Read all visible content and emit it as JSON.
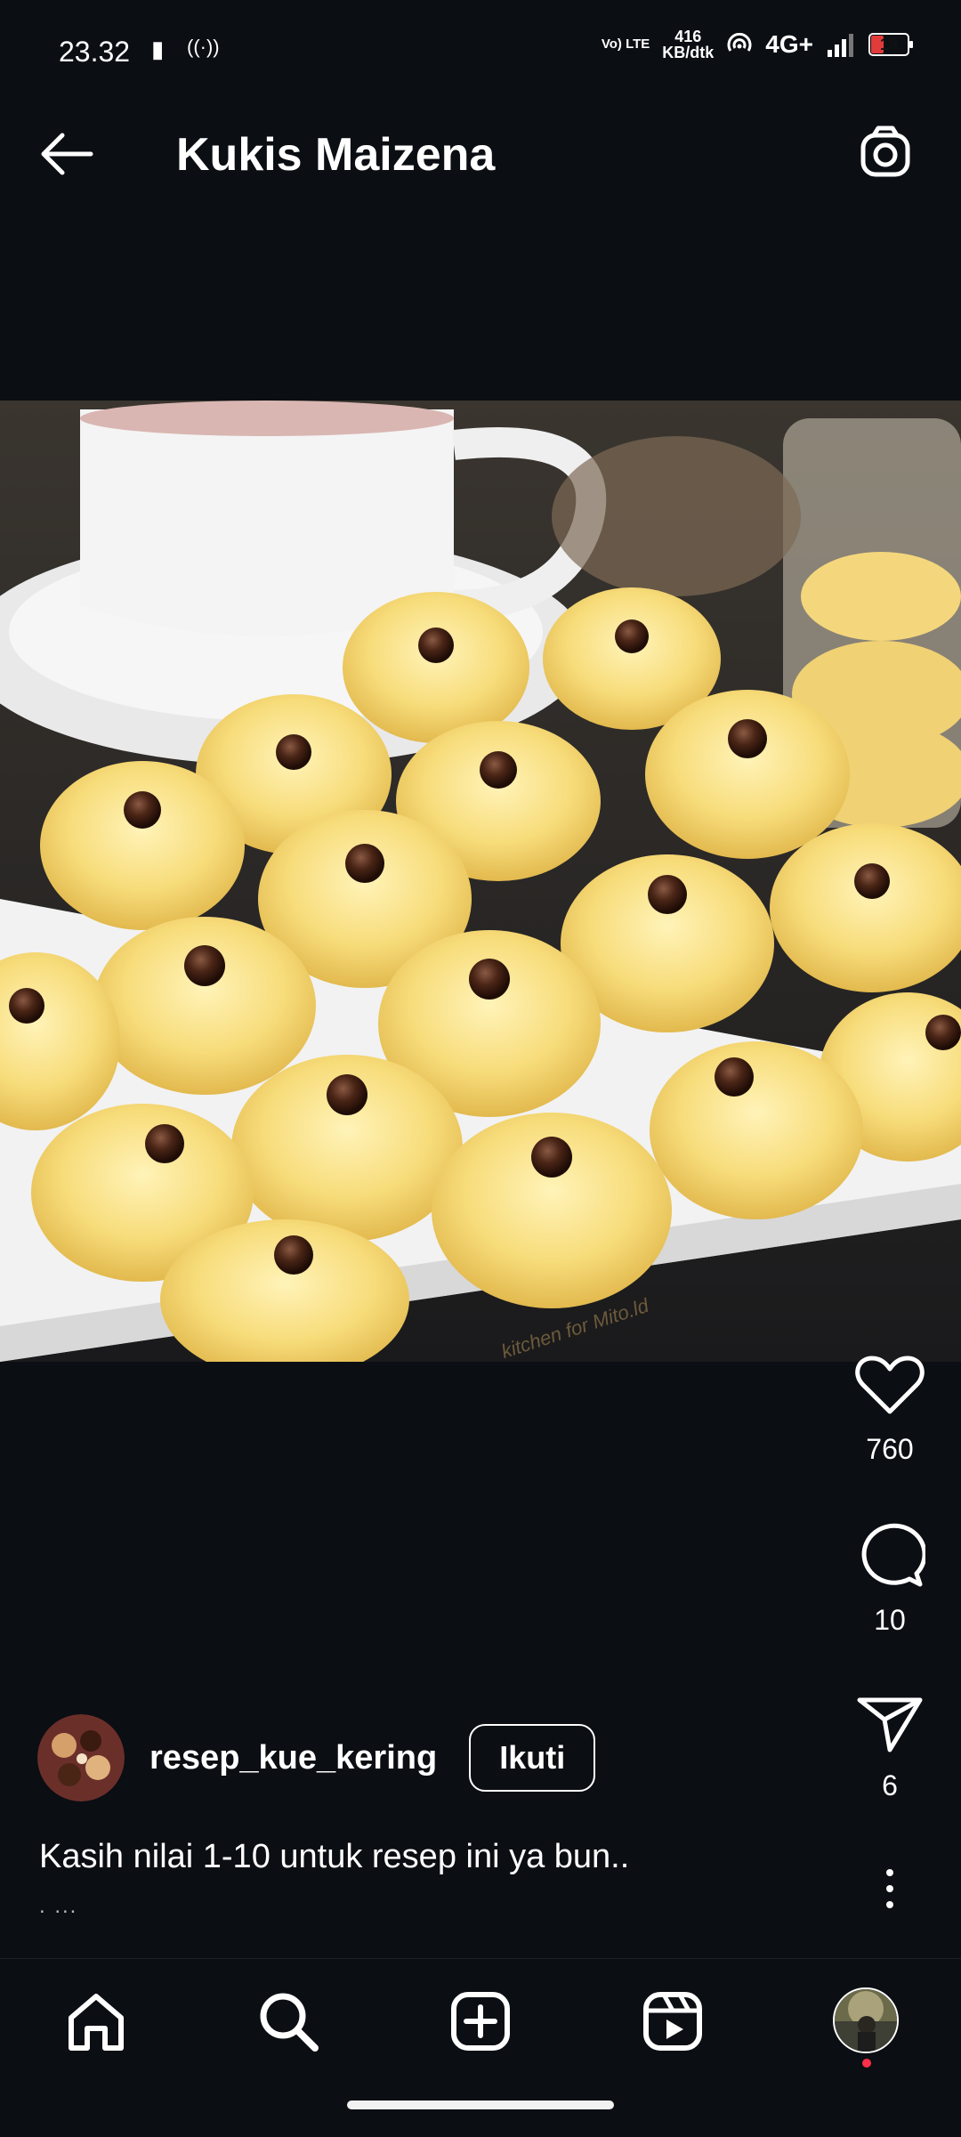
{
  "status": {
    "time": "23.32",
    "net_speed": "416",
    "net_unit": "KB/dtk",
    "network": "4G+",
    "battery": "18",
    "volte": "Vo) LTE"
  },
  "header": {
    "title": "Kukis Maizena"
  },
  "post": {
    "likes": "760",
    "comments": "10",
    "shares": "6",
    "username": "resep_kue_kering",
    "follow_label": "Ikuti",
    "caption": "Kasih nilai 1-10 untuk resep ini ya bun..",
    "caption_more": ". ...",
    "image_watermark": "kitchen for Mito.ld"
  },
  "colors": {
    "background": "#0b0e13",
    "accent_dot": "#ff2f4a",
    "cookie": "#f5d878",
    "chocolate": "#4a2516"
  },
  "icons": [
    "back-arrow-icon",
    "camera-icon",
    "heart-icon",
    "comment-icon",
    "send-icon",
    "more-vertical-icon",
    "home-icon",
    "search-icon",
    "add-icon",
    "reels-icon",
    "profile-avatar"
  ]
}
